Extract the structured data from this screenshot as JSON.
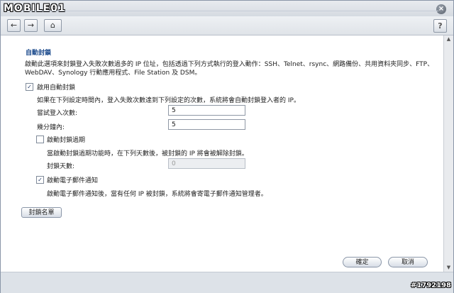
{
  "watermark": {
    "logo": "MOBILE01",
    "id": "#1792198"
  },
  "toolbar": {
    "back_icon": "←",
    "forward_icon": "→",
    "home_icon": "⌂",
    "help": "?"
  },
  "window": {
    "close_icon": "×"
  },
  "section": {
    "title": "自動封鎖",
    "description": "啟動此選項來封鎖登入失敗次數過多的 IP 位址，包括透過下列方式執行的登入動作：SSH、Telnet、rsync、網路備份、共用資料夾同步、FTP、WebDAV、Synology 行動應用程式、File Station 及 DSM。"
  },
  "auto_block": {
    "label": "啟用自動封鎖",
    "checked": true,
    "note": "如果在下列設定時間內，登入失敗次數達到下列設定的次數，系統將會自動封鎖登入者的 IP。",
    "attempts_label": "嘗試登入次數:",
    "attempts_value": "5",
    "minutes_label": "幾分鐘內:",
    "minutes_value": "5"
  },
  "expiry": {
    "label": "啟動封鎖過期",
    "checked": false,
    "note": "當啟動封鎖過期功能時，在下列天數後，被封鎖的 IP 將會被解除封鎖。",
    "days_label": "封鎖天數:",
    "days_value": "0"
  },
  "email": {
    "label": "啟動電子郵件通知",
    "checked": true,
    "note": "啟動電子郵件通知後，當有任何 IP 被封鎖，系統將會寄電子郵件通知管理者。"
  },
  "buttons": {
    "block_list": "封鎖名單",
    "ok": "確定",
    "cancel": "取消"
  }
}
